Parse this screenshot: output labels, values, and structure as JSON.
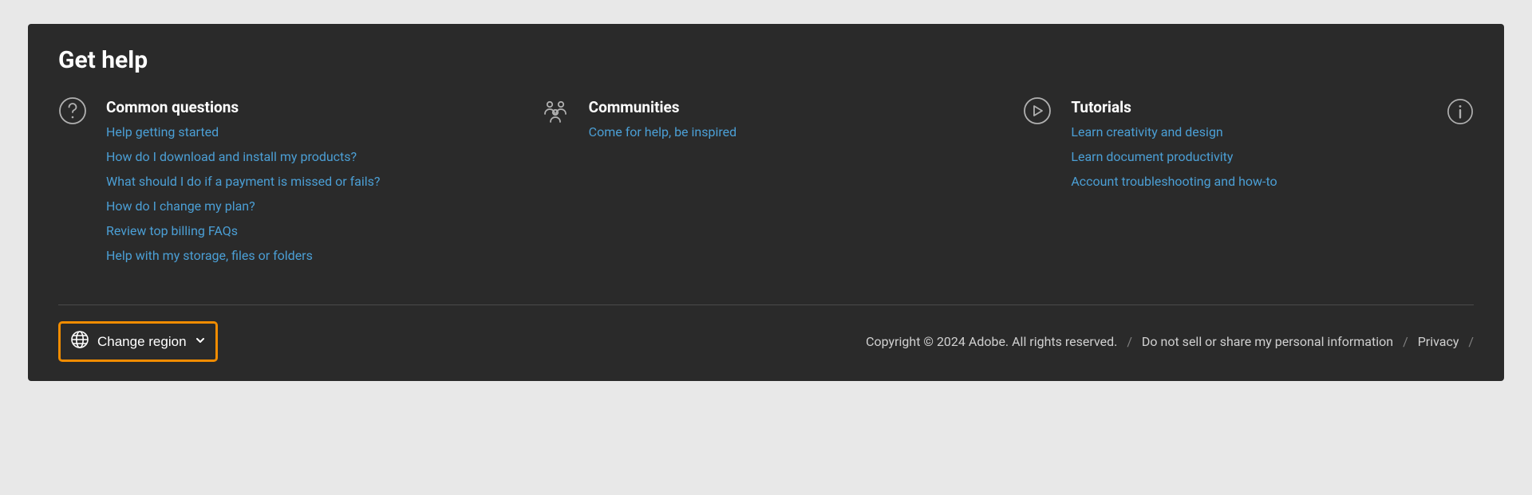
{
  "header": {
    "title": "Get help"
  },
  "columns": {
    "common": {
      "title": "Common questions",
      "links": [
        "Help getting started",
        "How do I download and install my products?",
        "What should I do if a payment is missed or fails?",
        "How do I change my plan?",
        "Review top billing FAQs",
        "Help with my storage, files or folders"
      ]
    },
    "communities": {
      "title": "Communities",
      "links": [
        "Come for help, be inspired"
      ]
    },
    "tutorials": {
      "title": "Tutorials",
      "links": [
        "Learn creativity and design",
        "Learn document productivity",
        "Account troubleshooting and how-to"
      ]
    }
  },
  "footer": {
    "region_label": "Change region",
    "copyright": "Copyright © 2024 Adobe. All rights reserved.",
    "link_do_not_sell": "Do not sell or share my personal information",
    "link_privacy": "Privacy",
    "separator": "/"
  }
}
